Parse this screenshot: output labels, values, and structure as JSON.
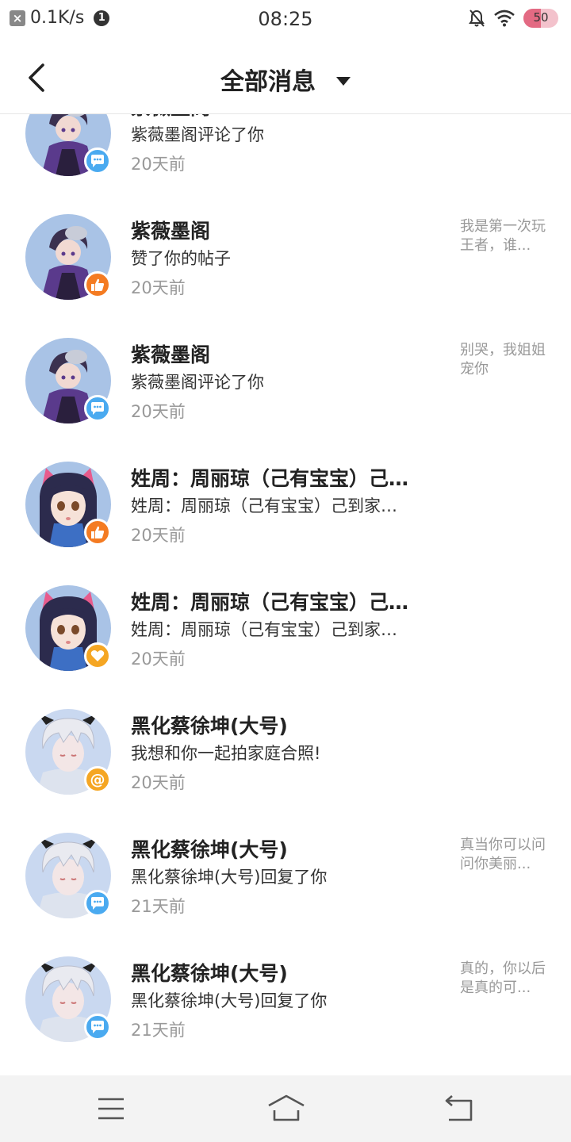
{
  "status_bar": {
    "network_speed": "0.1K/s",
    "notification_count": "1",
    "time": "08:25",
    "battery_level": "50"
  },
  "header": {
    "title": "全部消息",
    "back_icon": "chevron-left-icon",
    "dropdown_icon": "caret-down-icon"
  },
  "messages": [
    {
      "name": "紫薇墨阁",
      "action": "紫薇墨阁评论了你",
      "time": "20天前",
      "preview": "",
      "avatar": "purple-character",
      "type_icon": "comment-icon"
    },
    {
      "name": "紫薇墨阁",
      "action": "赞了你的帖子",
      "time": "20天前",
      "preview": "我是第一次玩王者，谁...",
      "avatar": "purple-character",
      "type_icon": "thumbs-up-icon"
    },
    {
      "name": "紫薇墨阁",
      "action": "紫薇墨阁评论了你",
      "time": "20天前",
      "preview": "别哭，我姐姐宠你",
      "avatar": "purple-character",
      "type_icon": "comment-icon"
    },
    {
      "name": "姓周：周丽琼（己有宝宝）己…",
      "action": "姓周：周丽琼（己有宝宝）己到家…",
      "time": "20天前",
      "preview": "",
      "avatar": "cat-ear-girl",
      "type_icon": "thumbs-up-icon"
    },
    {
      "name": "姓周：周丽琼（己有宝宝）己…",
      "action": "姓周：周丽琼（己有宝宝）己到家…",
      "time": "20天前",
      "preview": "",
      "avatar": "cat-ear-girl",
      "type_icon": "heart-icon"
    },
    {
      "name": "黑化蔡徐坤(大号)",
      "action": "我想和你一起拍家庭合照!",
      "time": "20天前",
      "preview": "",
      "avatar": "white-hair-boy",
      "type_icon": "at-icon"
    },
    {
      "name": "黑化蔡徐坤(大号)",
      "action": "黑化蔡徐坤(大号)回复了你",
      "time": "21天前",
      "preview": "真当你可以问问你美丽...",
      "avatar": "white-hair-boy",
      "type_icon": "comment-icon"
    },
    {
      "name": "黑化蔡徐坤(大号)",
      "action": "黑化蔡徐坤(大号)回复了你",
      "time": "21天前",
      "preview": "真的，你以后是真的可...",
      "avatar": "white-hair-boy",
      "type_icon": "comment-icon"
    }
  ],
  "bottom_nav": {
    "menu_icon": "menu-icon",
    "home_icon": "home-icon",
    "back_icon": "back-icon"
  },
  "colors": {
    "comment_badge": "#4aaaf0",
    "like_badge": "#f47b22",
    "heart_badge": "#f5a623",
    "at_badge": "#f5a623",
    "battery": "#e36a83"
  }
}
